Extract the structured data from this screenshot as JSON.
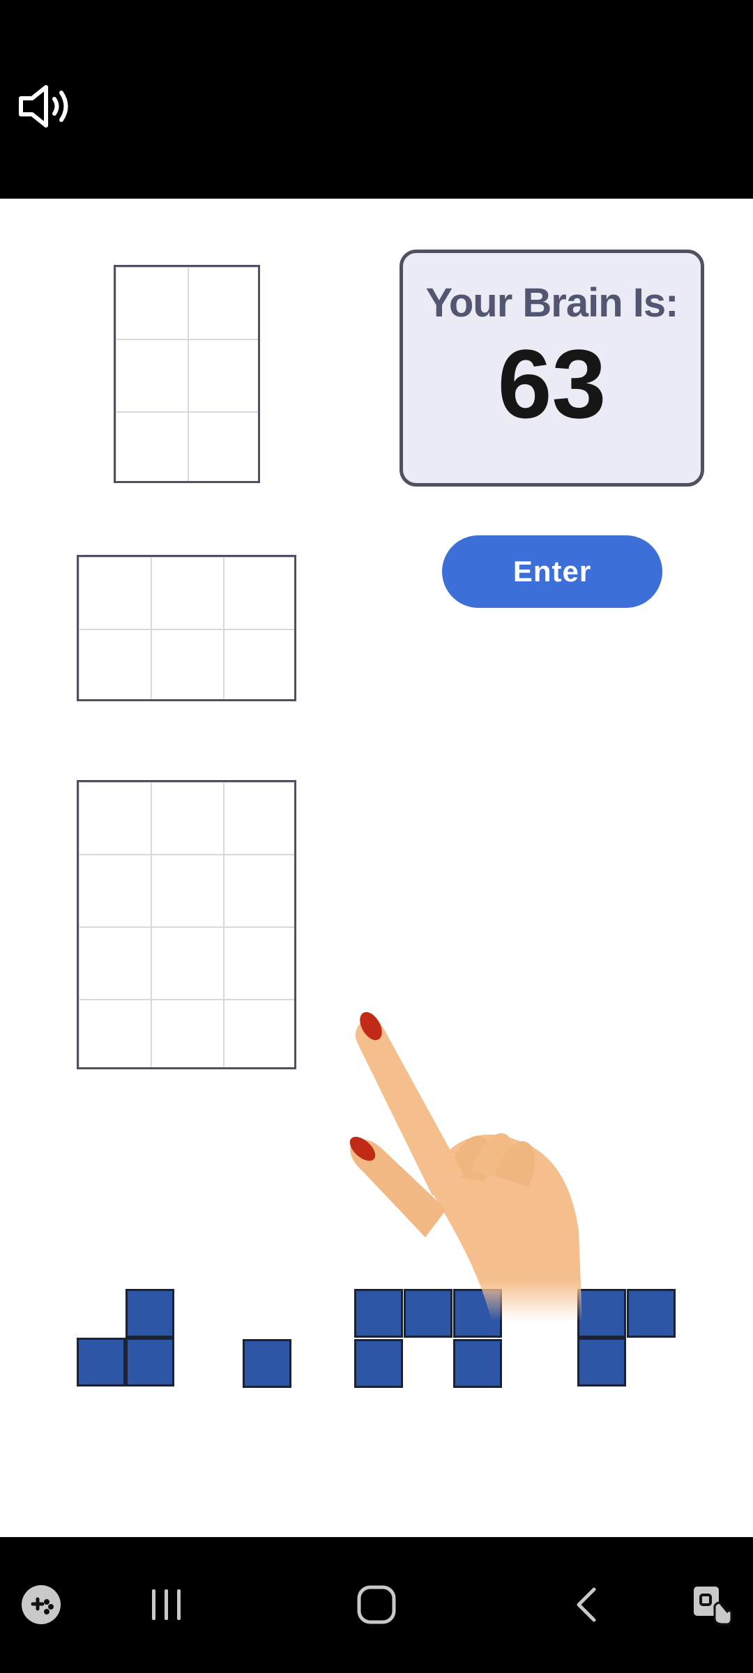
{
  "score_panel": {
    "label": "Your Brain Is:",
    "value": "63"
  },
  "enter_button": {
    "label": "Enter"
  },
  "grids": [
    {
      "name": "target-grid-2x3",
      "columns": 2,
      "rows": 3
    },
    {
      "name": "target-grid-3x2",
      "columns": 3,
      "rows": 2
    },
    {
      "name": "target-grid-3x4",
      "columns": 3,
      "rows": 4
    }
  ],
  "pieces": [
    {
      "name": "piece-l-tromino",
      "cells": 3
    },
    {
      "name": "piece-single",
      "cells": 1
    },
    {
      "name": "piece-u-pentomino",
      "cells": 5
    },
    {
      "name": "piece-corner-tromino",
      "cells": 3
    }
  ],
  "colors": {
    "block_fill": "#2e56a6",
    "enter_button": "#3c6fd8",
    "score_panel_bg": "#ebebf5",
    "grid_border": "#4f5160"
  },
  "icons": {
    "sound": "speaker-icon",
    "game_launcher": "game-controller-icon",
    "recents": "recents-icon",
    "home": "home-icon",
    "back": "back-icon",
    "screen_lock": "touch-lock-icon"
  }
}
